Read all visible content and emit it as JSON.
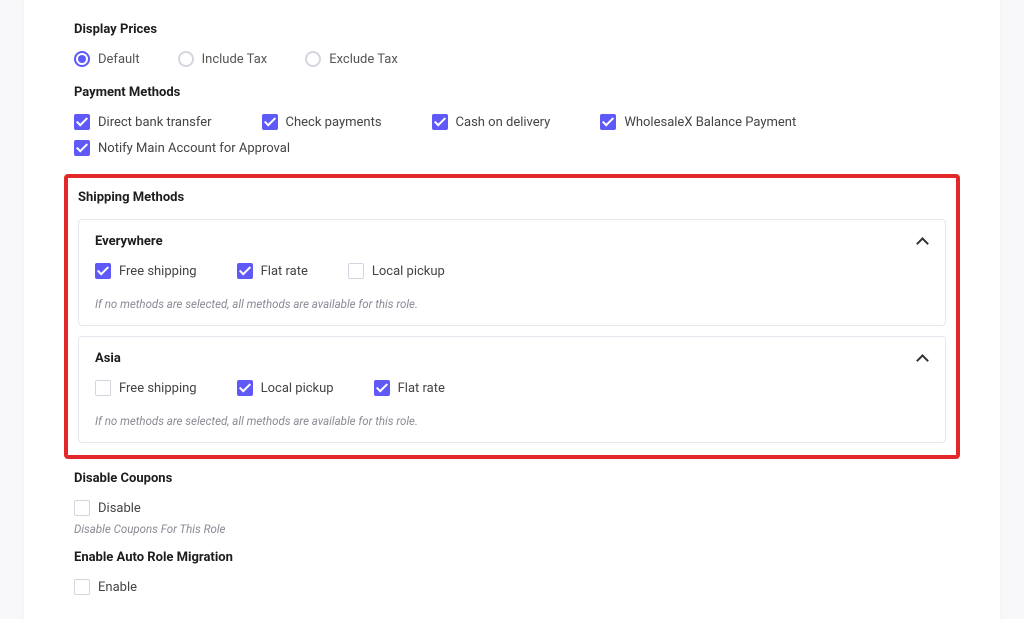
{
  "display_prices": {
    "title": "Display Prices",
    "options": [
      {
        "label": "Default",
        "selected": true
      },
      {
        "label": "Include Tax",
        "selected": false
      },
      {
        "label": "Exclude Tax",
        "selected": false
      }
    ]
  },
  "payment_methods": {
    "title": "Payment Methods",
    "items": [
      {
        "label": "Direct bank transfer",
        "checked": true
      },
      {
        "label": "Check payments",
        "checked": true
      },
      {
        "label": "Cash on delivery",
        "checked": true
      },
      {
        "label": "WholesaleX Balance Payment",
        "checked": true
      },
      {
        "label": "Notify Main Account for Approval",
        "checked": true
      }
    ]
  },
  "shipping_methods": {
    "title": "Shipping Methods",
    "note": "If no methods are selected, all methods are available for this role.",
    "zones": [
      {
        "name": "Everywhere",
        "methods": [
          {
            "label": "Free shipping",
            "checked": true
          },
          {
            "label": "Flat rate",
            "checked": true
          },
          {
            "label": "Local pickup",
            "checked": false
          }
        ]
      },
      {
        "name": "Asia",
        "methods": [
          {
            "label": "Free shipping",
            "checked": false
          },
          {
            "label": "Local pickup",
            "checked": true
          },
          {
            "label": "Flat rate",
            "checked": true
          }
        ]
      }
    ]
  },
  "disable_coupons": {
    "title": "Disable Coupons",
    "option_label": "Disable",
    "checked": false,
    "desc": "Disable Coupons For This Role"
  },
  "auto_role": {
    "title": "Enable Auto Role Migration",
    "option_label": "Enable",
    "checked": false
  }
}
